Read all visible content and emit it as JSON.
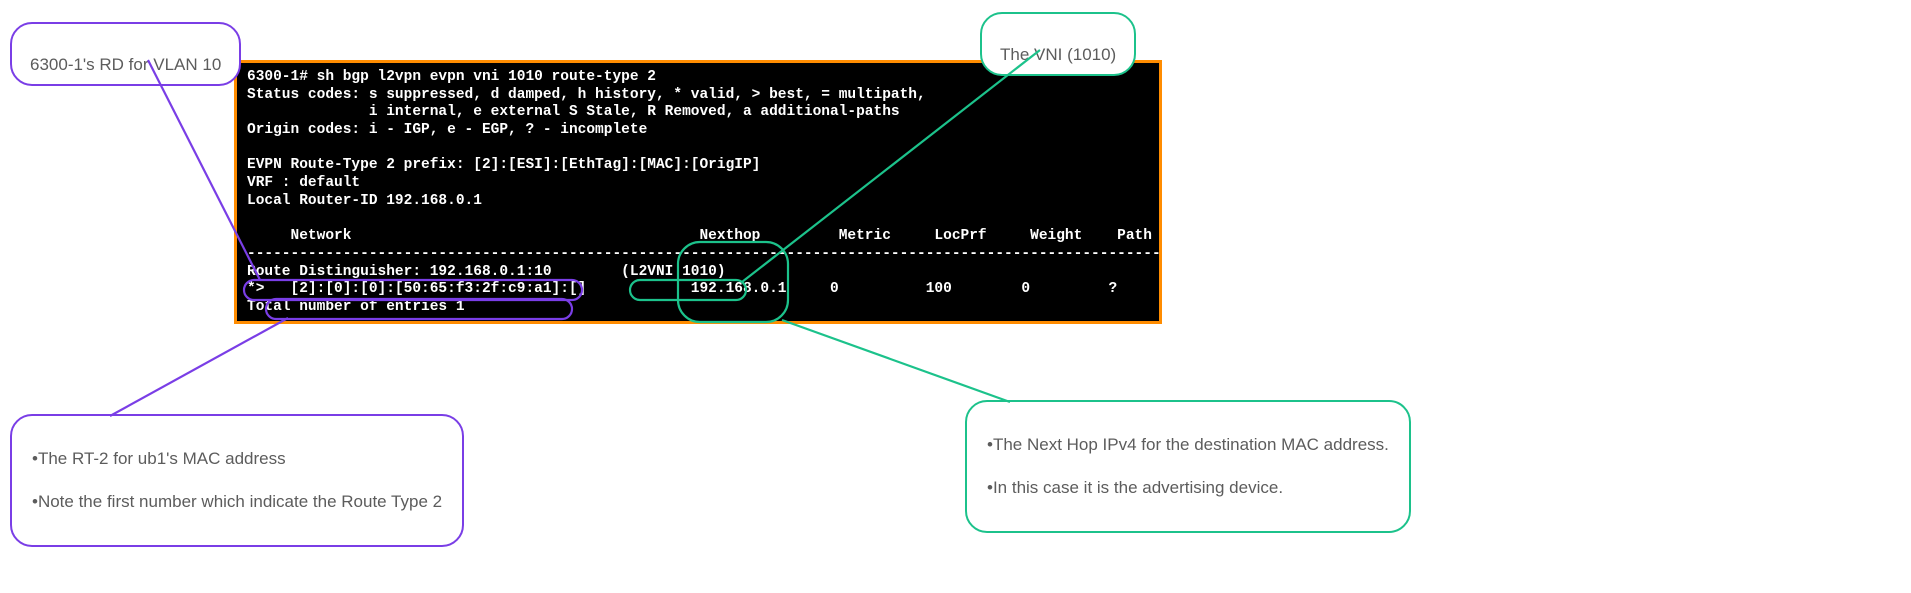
{
  "terminal": {
    "line1": "6300-1# sh bgp l2vpn evpn vni 1010 route-type 2",
    "line2": "Status codes: s suppressed, d damped, h history, * valid, > best, = multipath,",
    "line3": "              i internal, e external S Stale, R Removed, a additional-paths",
    "line4": "Origin codes: i - IGP, e - EGP, ? - incomplete",
    "line5": "",
    "line6": "EVPN Route-Type 2 prefix: [2]:[ESI]:[EthTag]:[MAC]:[OrigIP]",
    "line7": "VRF : default",
    "line8": "Local Router-ID 192.168.0.1",
    "line9": "",
    "line10": "     Network                                        Nexthop         Metric     LocPrf     Weight    Path",
    "line11": "------------------------------------------------------------------------------------------------------------",
    "line12": "Route Distinguisher: 192.168.0.1:10        (L2VNI 1010)",
    "line13": "*>   [2]:[0]:[0]:[50:65:f3:2f:c9:a1]:[]            192.168.0.1     0          100        0         ?",
    "line14": "Total number of entries 1"
  },
  "callouts": {
    "rd": "6300-1's RD for VLAN 10",
    "vni": "The VNI (1010)",
    "rt2_l1": "The RT-2 for ub1's MAC address",
    "rt2_l2": "Note the first number which indicate the Route Type 2",
    "nh_l1": "The Next Hop IPv4 for the destination MAC address.",
    "nh_l2": "In this case it is the advertising device."
  }
}
